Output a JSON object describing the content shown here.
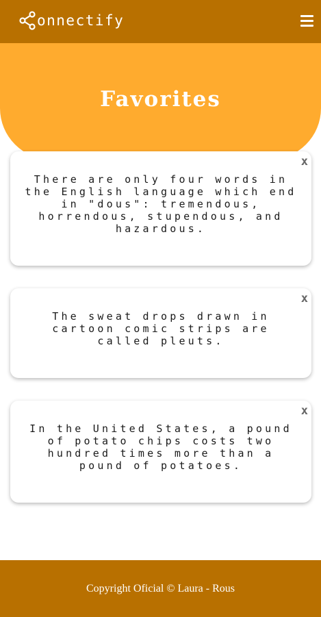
{
  "header": {
    "logo_text": "onnectify",
    "logo_icon": "share-icon",
    "menu_icon": "hamburger-menu-icon"
  },
  "hero": {
    "title": "Favorites"
  },
  "favorites": [
    {
      "text": "There are only four words in the English language which end in \"dous\": tremendous, horrendous, stupendous, and hazardous.",
      "close_label": "x"
    },
    {
      "text": "The sweat drops drawn in cartoon comic strips are called pleuts.",
      "close_label": "x"
    },
    {
      "text": "In the United States, a pound of potato chips costs two hundred times more than a pound of potatoes.",
      "close_label": "x"
    }
  ],
  "footer": {
    "copyright": "Copyright Oficial © Laura - Rous"
  },
  "colors": {
    "navbar": "#b87000",
    "hero": "#ffab2e",
    "footer": "#b87000"
  }
}
